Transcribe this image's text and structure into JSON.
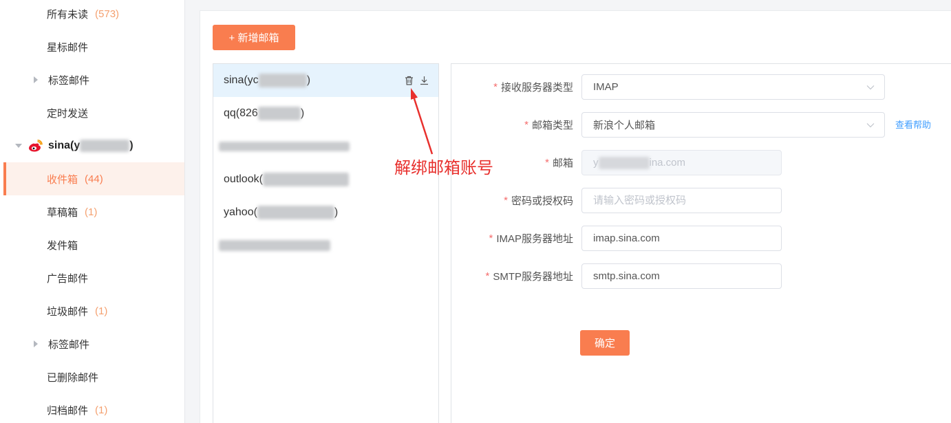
{
  "colors": {
    "accent": "#f97d4f",
    "count": "#f4a06f",
    "selected_bg": "#fdf1eb",
    "active_account_bg": "#e6f3fd",
    "required": "#f56c6c",
    "link": "#409eff",
    "annotation": "#e8302d"
  },
  "sidebar": {
    "items": [
      {
        "label": "所有未读",
        "count": "(573)"
      },
      {
        "label": "星标邮件"
      },
      {
        "label": "标签邮件",
        "icon": "caret-right-icon"
      },
      {
        "label": "定时发送"
      }
    ],
    "account": {
      "name_prefix": "sina(y",
      "name_suffix": ")",
      "icon": "weibo-icon",
      "expand_icon": "caret-down-icon"
    },
    "folders": [
      {
        "label": "收件箱",
        "count": "(44)",
        "selected": true
      },
      {
        "label": "草稿箱",
        "count": "(1)"
      },
      {
        "label": "发件箱"
      },
      {
        "label": "广告邮件"
      },
      {
        "label": "垃圾邮件",
        "count": "(1)"
      },
      {
        "label": "标签邮件",
        "icon": "caret-right-icon"
      },
      {
        "label": "已删除邮件"
      },
      {
        "label": "归档邮件",
        "count": "(1)"
      }
    ]
  },
  "toolbar": {
    "add_mailbox_label": "+ 新增邮箱"
  },
  "accounts": {
    "items": [
      {
        "name_prefix": "sina(yc",
        "name_suffix": ")",
        "active": true,
        "actions": [
          "trash-icon",
          "download-icon"
        ]
      },
      {
        "name_prefix": "qq(826",
        "name_suffix": ")"
      },
      {
        "redacted": true
      },
      {
        "name_prefix": "outlook("
      },
      {
        "name_prefix": "yahoo(",
        "name_suffix": ")"
      },
      {
        "redacted": true
      }
    ]
  },
  "annotation": {
    "text": "解绑邮箱账号"
  },
  "form": {
    "required_mark": "*",
    "receive_server_type": {
      "label": "接收服务器类型",
      "value": "IMAP"
    },
    "mailbox_type": {
      "label": "邮箱类型",
      "value": "新浪个人邮箱",
      "help_link": "查看帮助"
    },
    "email": {
      "label": "邮箱",
      "value_prefix": "y",
      "value_suffix": "ina.com",
      "disabled": true
    },
    "password": {
      "label": "密码或授权码",
      "placeholder": "请输入密码或授权码"
    },
    "imap_server": {
      "label": "IMAP服务器地址",
      "value": "imap.sina.com"
    },
    "smtp_server": {
      "label": "SMTP服务器地址",
      "value": "smtp.sina.com"
    },
    "submit_label": "确定"
  }
}
